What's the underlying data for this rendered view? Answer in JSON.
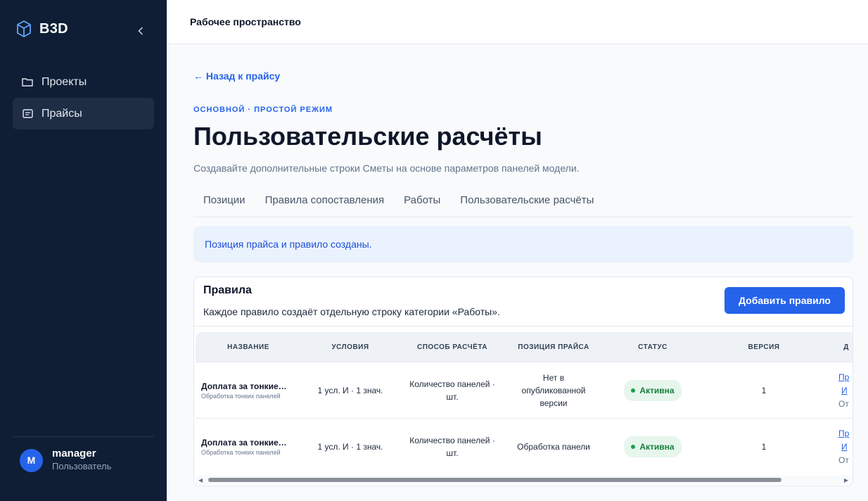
{
  "sidebar": {
    "brand": "B3D",
    "items": [
      {
        "label": "Проекты",
        "icon": "folder-icon"
      },
      {
        "label": "Прайсы",
        "icon": "price-list-icon",
        "active": true
      }
    ],
    "user": {
      "initial": "M",
      "name": "manager",
      "role": "Пользователь"
    }
  },
  "topbar": {
    "title": "Рабочее пространство"
  },
  "main": {
    "back_link": "← Назад к прайсу",
    "eyebrow": "ОСНОВНОЙ · ПРОСТОЙ РЕЖИМ",
    "title": "Пользовательские расчёты",
    "description": "Создавайте дополнительные строки Сметы на основе параметров панелей модели.",
    "tabs": [
      "Позиции",
      "Правила сопоставления",
      "Работы",
      "Пользовательские расчёты"
    ],
    "alert": "Позиция прайса и правило созданы."
  },
  "rules": {
    "title": "Правила",
    "subtitle": "Каждое правило создаёт отдельную строку категории «Работы».",
    "add_button": "Добавить правило",
    "columns": [
      "НАЗВАНИЕ",
      "УСЛОВИЯ",
      "СПОСОБ РАСЧЁТА",
      "ПОЗИЦИЯ ПРАЙСА",
      "СТАТУС",
      "ВЕРСИЯ",
      "Д"
    ],
    "rows": [
      {
        "name": "Доплата за тонкие…",
        "sub": "Обработка тонких панелей",
        "conditions": "1 усл. И · 1 знач.",
        "method": "Количество панелей · шт.",
        "price_item": "Нет в опубликованной версии",
        "status": "Активна",
        "version": "1",
        "actions": [
          "Пр",
          "И",
          "От"
        ]
      },
      {
        "name": "Доплата за тонкие…",
        "sub": "Обработка тонких панелей",
        "conditions": "1 усл. И · 1 знач.",
        "method": "Количество панелей · шт.",
        "price_item": "Обработка панели",
        "status": "Активна",
        "version": "1",
        "actions": [
          "Пр",
          "И",
          "От"
        ]
      }
    ]
  },
  "colors": {
    "sidebar_bg": "#0f1e35",
    "accent": "#2563eb",
    "status_active": "#15803d"
  }
}
